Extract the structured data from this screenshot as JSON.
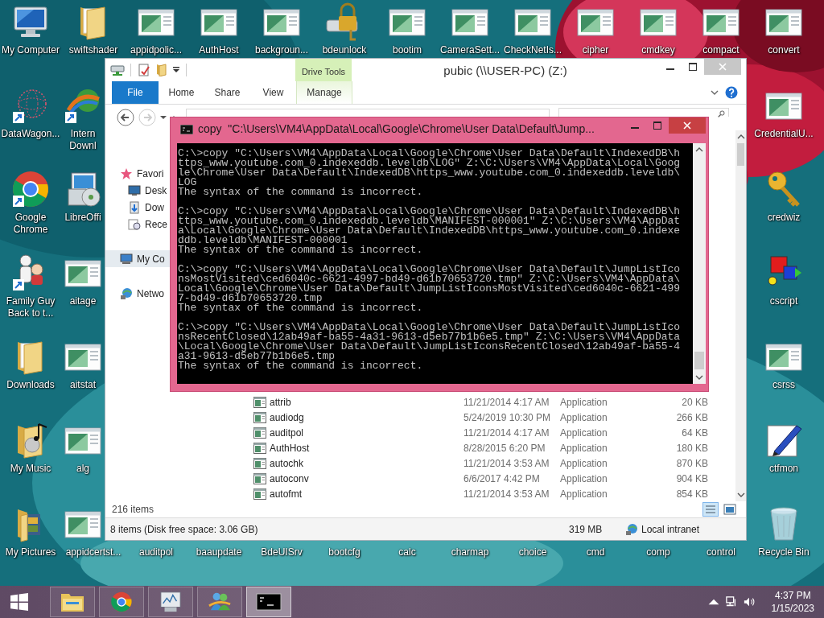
{
  "desktop": {
    "left_columns": [
      [
        {
          "label": "My Computer",
          "kind": "computer"
        },
        {
          "label": "DataWagon...",
          "kind": "sphere"
        },
        {
          "label": "Google Chrome",
          "kind": "browser"
        },
        {
          "label": "Family Guy Back to t...",
          "kind": "figures"
        },
        {
          "label": "Downloads",
          "kind": "folder"
        },
        {
          "label": "My Music",
          "kind": "music-folder"
        },
        {
          "label": "My Pictures",
          "kind": "pictures-folder"
        }
      ],
      [
        {
          "label": "swiftshader",
          "kind": "folder"
        },
        {
          "label": "Intern Downl",
          "kind": "globe"
        },
        {
          "label": "LibreOffi",
          "kind": "installer"
        },
        {
          "label": "aitage",
          "kind": "app"
        },
        {
          "label": "aitstat",
          "kind": "app"
        },
        {
          "label": "alg",
          "kind": "app"
        },
        {
          "label": "appidcertst...",
          "kind": "app"
        }
      ]
    ],
    "top_row": [
      {
        "label": "appidpolic...",
        "kind": "app"
      },
      {
        "label": "AuthHost",
        "kind": "app"
      },
      {
        "label": "backgroun...",
        "kind": "app"
      },
      {
        "label": "bdeunlock",
        "kind": "padlock-drive"
      },
      {
        "label": "bootim",
        "kind": "app"
      },
      {
        "label": "CameraSett...",
        "kind": "app"
      },
      {
        "label": "CheckNetIs...",
        "kind": "app"
      },
      {
        "label": "cipher",
        "kind": "app"
      },
      {
        "label": "cmdkey",
        "kind": "app"
      },
      {
        "label": "compact",
        "kind": "app"
      }
    ],
    "bottom_row": [
      {
        "label": "auditpol"
      },
      {
        "label": "baaupdate"
      },
      {
        "label": "BdeUISrv"
      },
      {
        "label": "bootcfg"
      },
      {
        "label": "calc"
      },
      {
        "label": "charmap"
      },
      {
        "label": "choice"
      },
      {
        "label": "cmd"
      },
      {
        "label": "comp"
      },
      {
        "label": "control"
      }
    ],
    "right_column": [
      {
        "label": "convert",
        "kind": "app"
      },
      {
        "label": "CredentialU...",
        "kind": "app"
      },
      {
        "label": "credwiz",
        "kind": "key"
      },
      {
        "label": "cscript",
        "kind": "shapes"
      },
      {
        "label": "csrss",
        "kind": "app"
      },
      {
        "label": "ctfmon",
        "kind": "pen"
      },
      {
        "label": "Recycle Bin",
        "kind": "recycle-bin"
      }
    ]
  },
  "explorer": {
    "title": "pubic (\\\\USER-PC) (Z:)",
    "context_header": "Drive Tools",
    "tabs": [
      {
        "label": "File",
        "kind": "file"
      },
      {
        "label": "Home",
        "kind": "tab"
      },
      {
        "label": "Share",
        "kind": "tab"
      },
      {
        "label": "View",
        "kind": "tab"
      },
      {
        "label": "Manage",
        "kind": "context"
      }
    ],
    "nav": [
      {
        "label": "Favori",
        "kind": "favorites",
        "selected": false,
        "children": [
          {
            "label": "Desk",
            "kind": "desktop",
            "selected": false
          },
          {
            "label": "Dow",
            "kind": "downloads",
            "selected": false
          },
          {
            "label": "Rece",
            "kind": "recent",
            "selected": false
          }
        ]
      },
      {
        "label": "My Co",
        "kind": "computer",
        "selected": true
      },
      {
        "label": "Netwo",
        "kind": "network",
        "selected": false
      }
    ],
    "files": [
      {
        "name": "attrib",
        "date": "11/21/2014 4:17 AM",
        "type": "Application",
        "size": "20 KB"
      },
      {
        "name": "audiodg",
        "date": "5/24/2019 10:30 PM",
        "type": "Application",
        "size": "266 KB"
      },
      {
        "name": "auditpol",
        "date": "11/21/2014 4:17 AM",
        "type": "Application",
        "size": "64 KB"
      },
      {
        "name": "AuthHost",
        "date": "8/28/2015 6:20 PM",
        "type": "Application",
        "size": "180 KB"
      },
      {
        "name": "autochk",
        "date": "11/21/2014 3:53 AM",
        "type": "Application",
        "size": "870 KB"
      },
      {
        "name": "autoconv",
        "date": "6/6/2017 4:42 PM",
        "type": "Application",
        "size": "904 KB"
      },
      {
        "name": "autofmt",
        "date": "11/21/2014 3:53 AM",
        "type": "Application",
        "size": "854 KB"
      }
    ],
    "item_count": "216 items",
    "status": {
      "items": "8 items (Disk free space: 3.06 GB)",
      "size": "319 MB",
      "zone": "Local intranet"
    }
  },
  "console": {
    "title": "copy  \"C:\\Users\\VM4\\AppData\\Local\\Google\\Chrome\\User Data\\Default\\Jump...",
    "blocks": [
      {
        "lines": [
          "C:\\>copy \"C:\\Users\\VM4\\AppData\\Local\\Google\\Chrome\\User Data\\Default\\IndexedDB\\h",
          "ttps_www.youtube.com_0.indexeddb.leveldb\\LOG\" Z:\\C:\\Users\\VM4\\AppData\\Local\\Goog",
          "le\\Chrome\\User Data\\Default\\IndexedDB\\https_www.youtube.com_0.indexeddb.leveldb\\",
          "LOG",
          "The syntax of the command is incorrect."
        ]
      },
      {
        "lines": [
          "C:\\>copy \"C:\\Users\\VM4\\AppData\\Local\\Google\\Chrome\\User Data\\Default\\IndexedDB\\h",
          "ttps_www.youtube.com_0.indexeddb.leveldb\\MANIFEST-000001\" Z:\\C:\\Users\\VM4\\AppDat",
          "a\\Local\\Google\\Chrome\\User Data\\Default\\IndexedDB\\https_www.youtube.com_0.indexe",
          "ddb.leveldb\\MANIFEST-000001",
          "The syntax of the command is incorrect."
        ]
      },
      {
        "lines": [
          "C:\\>copy \"C:\\Users\\VM4\\AppData\\Local\\Google\\Chrome\\User Data\\Default\\JumpListIco",
          "nsMostVisited\\ced6040c-6621-4997-bd49-d61b70653720.tmp\" Z:\\C:\\Users\\VM4\\AppData\\",
          "Local\\Google\\Chrome\\User Data\\Default\\JumpListIconsMostVisited\\ced6040c-6621-499",
          "7-bd49-d61b70653720.tmp",
          "The syntax of the command is incorrect."
        ]
      },
      {
        "lines": [
          "C:\\>copy \"C:\\Users\\VM4\\AppData\\Local\\Google\\Chrome\\User Data\\Default\\JumpListIco",
          "nsRecentClosed\\12ab49af-ba55-4a31-9613-d5eb77b1b6e5.tmp\" Z:\\C:\\Users\\VM4\\AppData",
          "\\Local\\Google\\Chrome\\User Data\\Default\\JumpListIconsRecentClosed\\12ab49af-ba55-4",
          "a31-9613-d5eb77b1b6e5.tmp",
          "The syntax of the command is incorrect."
        ]
      }
    ]
  },
  "taskbar": {
    "buttons": [
      {
        "kind": "explorer",
        "selected": false
      },
      {
        "kind": "browser",
        "selected": false
      },
      {
        "kind": "monitor",
        "selected": false
      },
      {
        "kind": "messenger",
        "selected": false
      },
      {
        "kind": "console",
        "selected": true
      }
    ],
    "clock": {
      "time": "4:37 PM",
      "date": "1/15/2023"
    }
  }
}
